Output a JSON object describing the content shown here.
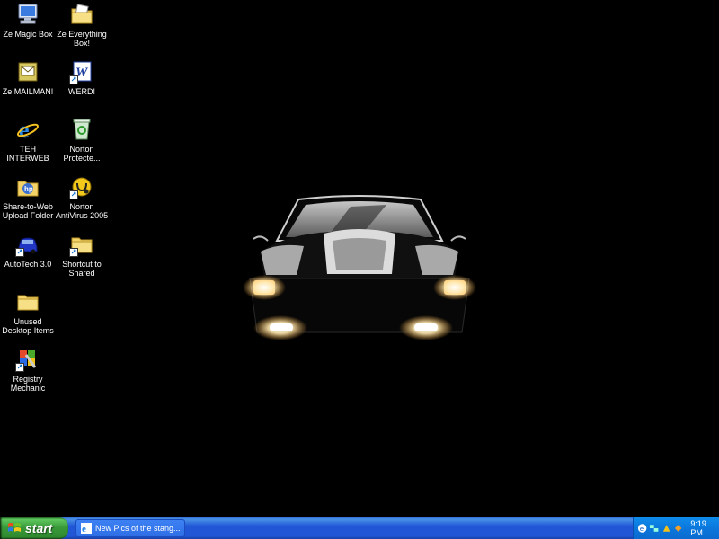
{
  "desktop": {
    "icons": [
      {
        "label": "Ze Magic Box",
        "name": "my-computer-icon"
      },
      {
        "label": "Ze Everything\nBox!",
        "name": "my-documents-icon"
      },
      {
        "label": "Ze MAILMAN!",
        "name": "mail-icon"
      },
      {
        "label": "WERD!",
        "name": "word-icon"
      },
      {
        "label": "TEH INTERWEB",
        "name": "internet-explorer-icon"
      },
      {
        "label": "Norton\nProtecte...",
        "name": "norton-recycle-bin-icon"
      },
      {
        "label": "Share-to-Web\nUpload Folder",
        "name": "share-to-web-folder-icon"
      },
      {
        "label": "Norton\nAntiVirus 2005",
        "name": "norton-antivirus-icon"
      },
      {
        "label": "AutoTech 3.0",
        "name": "autotech-car-icon"
      },
      {
        "label": "Shortcut to\nShared",
        "name": "shared-folder-shortcut-icon"
      },
      {
        "label": "Unused\nDesktop Items",
        "name": "unused-items-folder-icon"
      },
      {
        "label": "Registry\nMechanic",
        "name": "registry-mechanic-icon"
      }
    ]
  },
  "taskbar": {
    "start_label": "start",
    "task_item_label": "New Pics of the stang...",
    "clock": "9:19 PM"
  },
  "colors": {
    "taskbar_blue": "#2157d7",
    "start_green": "#3a9a3a",
    "tray_blue": "#0b77dc"
  }
}
